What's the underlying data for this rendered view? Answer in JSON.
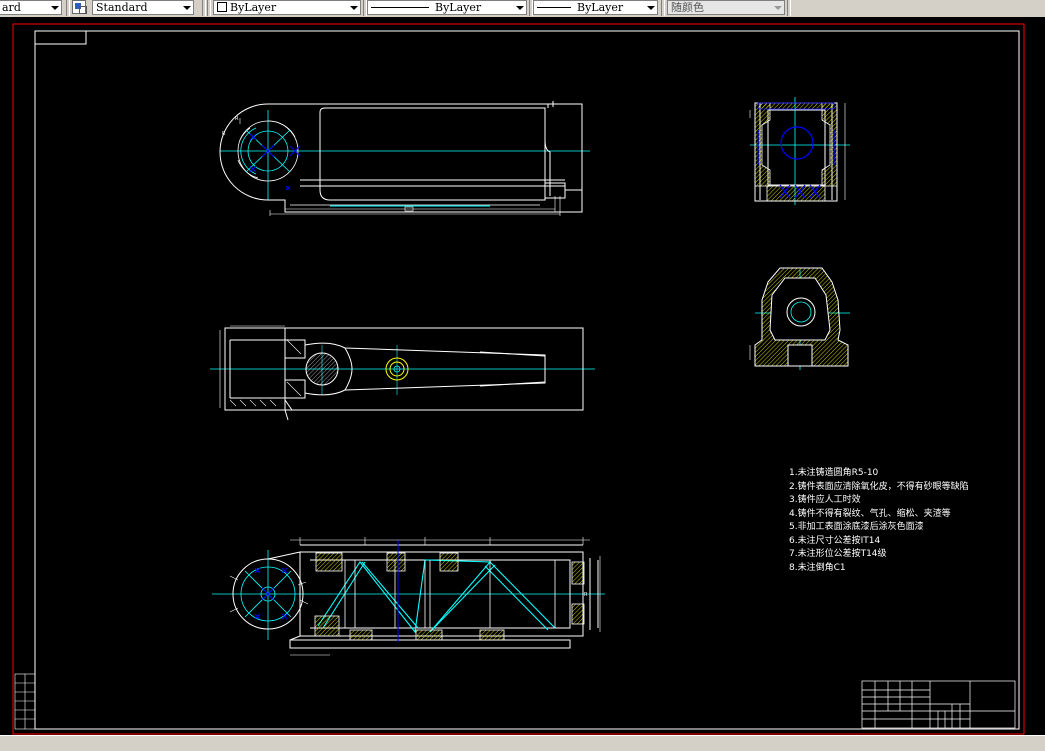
{
  "toolbar": {
    "text_style": "ard",
    "dim_style": "Standard",
    "layer": "ByLayer",
    "linetype": "ByLayer",
    "lineweight": "ByLayer",
    "plot_style": "随颜色"
  },
  "drawing": {
    "notes": [
      "1.未注铸造圆角R5-10",
      "2.铸件表面应清除氧化皮，不得有砂眼等缺陷",
      "3.铸件应人工时效",
      "4.铸件不得有裂纹、气孔、缩松、夹渣等",
      "5.非加工表面涂底漆后涂灰色面漆",
      "6.未注尺寸公差按IT14",
      "7.未注形位公差按T14级",
      "8.未注倒角C1"
    ],
    "colors": {
      "frame": "#ff0000",
      "lines": "#ffffff",
      "center": "#00ffff",
      "hatch": "#ffff00",
      "dims": "#0000ff"
    }
  }
}
